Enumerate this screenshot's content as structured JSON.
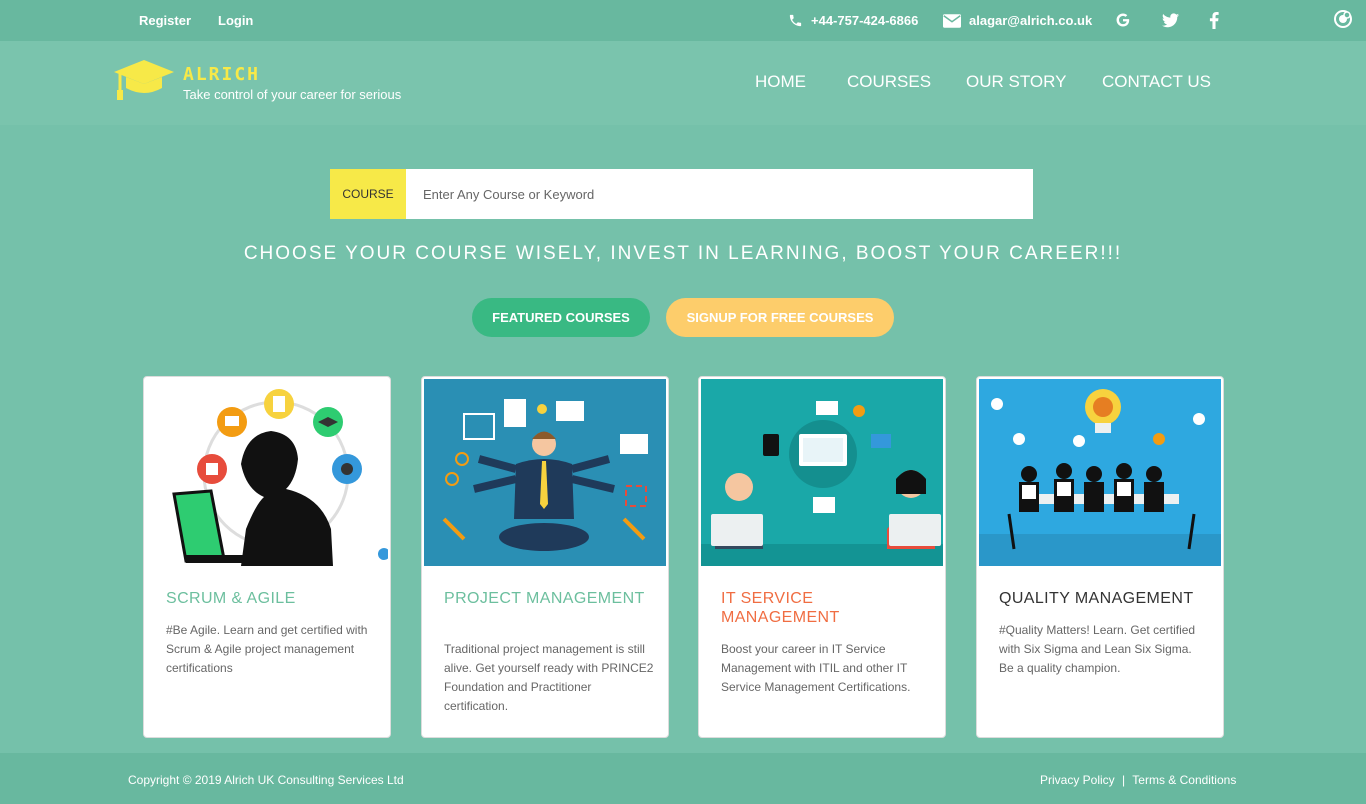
{
  "topbar": {
    "register": "Register",
    "login": "Login",
    "phone": "+44-757-424-6866",
    "email": "alagar@alrich.co.uk",
    "social": [
      "google-icon",
      "twitter-icon",
      "facebook-icon"
    ]
  },
  "brand": {
    "name": "ALRICH",
    "tagline": "Take control of your career for serious"
  },
  "nav": {
    "items": [
      "HOME",
      "COURSES",
      "OUR STORY",
      "CONTACT US"
    ]
  },
  "search": {
    "label": "COURSE",
    "placeholder": "Enter Any Course or Keyword"
  },
  "headline": "CHOOSE YOUR COURSE WISELY, INVEST IN LEARNING, BOOST YOUR CAREER!!!",
  "buttons": {
    "featured": "FEATURED COURSES",
    "signup": "SIGNUP FOR FREE COURSES"
  },
  "courses": [
    {
      "title": "SCRUM & AGILE",
      "description": "#Be Agile. Learn and get certified with Scrum & Agile project management certifications",
      "title_color": "#6cbf9e"
    },
    {
      "title": "PROJECT MANAGEMENT",
      "description": "Traditional project management is still alive. Get yourself ready with PRINCE2 Foundation and Practitioner certification.",
      "title_color": "#6cbf9e"
    },
    {
      "title": "IT SERVICE MANAGEMENT",
      "description": "Boost your career in IT Service Management with ITIL and other IT Service Management Certifications.",
      "title_color": "#f06d42"
    },
    {
      "title": "QUALITY MANAGEMENT",
      "description": "#Quality Matters! Learn. Get certified with Six Sigma and Lean Six Sigma. Be a quality champion.",
      "title_color": "#333333"
    }
  ],
  "footer": {
    "copyright": "Copyright © 2019 Alrich UK Consulting Services Ltd",
    "privacy": "Privacy Policy",
    "separator": "|",
    "terms": "Terms & Conditions"
  },
  "colors": {
    "background": "#75c1aa",
    "topbar": "#68b89f",
    "brand_yellow": "#f7e948",
    "featured_green": "#39b983",
    "signup_orange": "#fdcd6b"
  }
}
